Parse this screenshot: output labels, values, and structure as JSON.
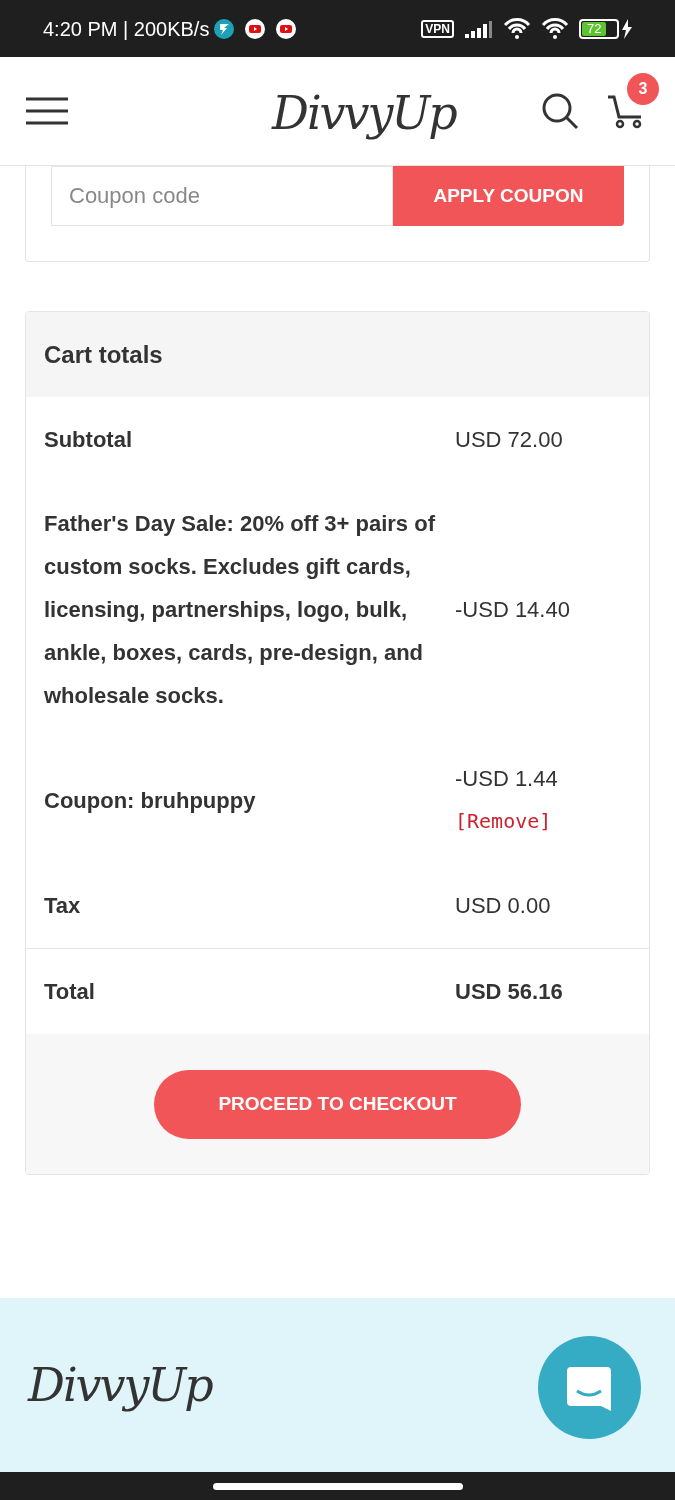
{
  "status_bar": {
    "time": "4:20 PM | 200KB/s",
    "vpn": "VPN",
    "battery": "72"
  },
  "header": {
    "logo": "DivvyUp",
    "cart_count": "3"
  },
  "coupon": {
    "placeholder": "Coupon code",
    "button": "APPLY COUPON"
  },
  "cart_totals": {
    "title": "Cart totals",
    "rows": [
      {
        "kind": "plain",
        "label": "Subtotal",
        "value": "USD 72.00"
      },
      {
        "kind": "plain",
        "label": "Father's Day Sale: 20% off 3+ pairs of custom socks. Excludes gift cards, licensing, partnerships, logo, bulk, ankle, boxes, cards, pre-design, and wholesale socks.",
        "value": "-USD 14.40"
      },
      {
        "kind": "coupon",
        "label": "Coupon: bruhpuppy",
        "value": "-USD 1.44",
        "link": "[Remove]"
      },
      {
        "kind": "plain",
        "label": "Tax",
        "value": "USD 0.00"
      },
      {
        "kind": "total",
        "label": "Total",
        "value": "USD 56.16"
      }
    ],
    "checkout_button": "PROCEED TO CHECKOUT"
  },
  "footer": {
    "logo": "DivvyUp"
  }
}
